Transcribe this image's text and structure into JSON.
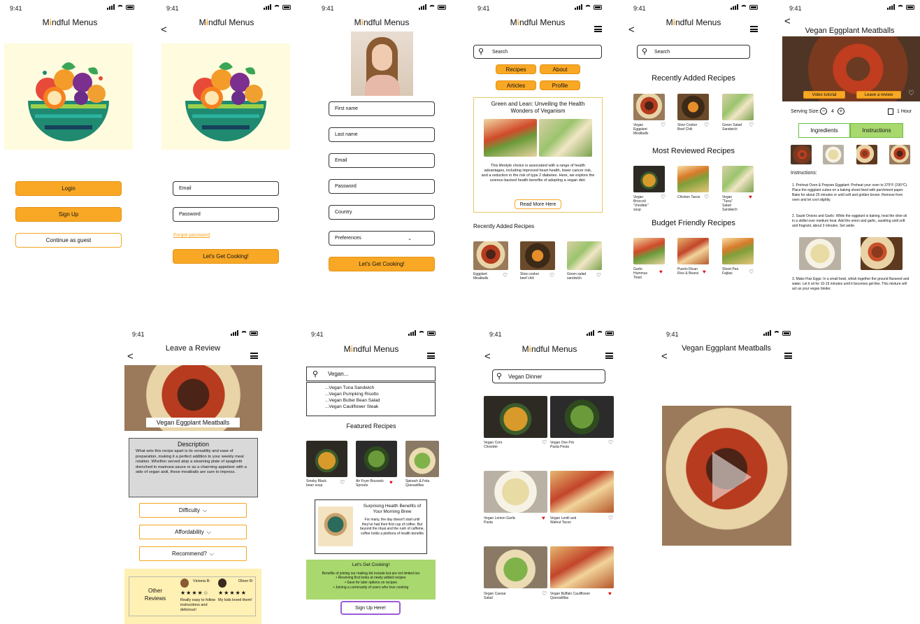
{
  "status_time": "9:41",
  "app_title_pre": "M",
  "app_title_dot": "i",
  "app_title_post": "ndful Menus",
  "s1": {
    "login": "Login",
    "signup": "Sign Up",
    "guest": "Continue as guest"
  },
  "s2": {
    "email": "Email",
    "password": "Password",
    "forgot": "Forgot password",
    "cta": "Let's Get Cooking!"
  },
  "s3": {
    "fields": [
      "First name",
      "Last name",
      "Email",
      "Password",
      "Country",
      "Preferences"
    ],
    "cta": "Let's Get Cooking!"
  },
  "s4": {
    "search": "Search",
    "nav": [
      "Recipes",
      "About",
      "Articles",
      "Profile"
    ],
    "article_title": "Green and Lean: Unveiling the Health Wonders of Veganism",
    "article_body": "This lifestyle choice is associated with a range of health advantages, including improved heart health, lower cancer risk, and a reduction in the risk of type 2 diabetes. Here, we explore the science-backed health benefits of adopting a vegan diet.",
    "read_more": "Read More Here",
    "recent_title": "Recently Added Recipes",
    "recent": [
      "Eggplant Meatballs",
      "Slow cooker beef chili",
      "Green salad sandwich"
    ]
  },
  "s5": {
    "search": "Search",
    "recent_title": "Recently Added Recipes",
    "recent": [
      "Vegan Eggplant Meatballs",
      "Slow Cooker Beef Chili",
      "Green Salad Sandwich"
    ],
    "reviewed_title": "Most Reviewed Recipes",
    "reviewed": [
      "Vegan Broccoli \"cheddar\" soup",
      "Chicken Tacos",
      "Vegan \"Tuna\" Salad Sandwich"
    ],
    "budget_title": "Budget Friendly Recipes",
    "budget": [
      "Garlic Hummus Toast",
      "Puerto Rican Rice & Beans",
      "Sheet Pan Fajitas"
    ]
  },
  "s6": {
    "title": "Vegan Eggplant Meatballs",
    "video": "Video tutorial",
    "review": "Leave a review",
    "serving": "Serving Size:",
    "serving_value": "4",
    "time": "1 Hour",
    "tab_ingredients": "Ingredients",
    "tab_instructions": "Instructions",
    "instructions_label": "Instructions:",
    "step1": "1. Preheat Oven & Prepare Eggplant: Preheat your oven to 375°F (190°C). Place the eggplant cubes on a baking sheet lined with parchment paper. Bake for about 25 minutes or until soft and golden brown. Remove from oven and let cool slightly.",
    "step2": "2. Sauté Onions and Garlic: While the eggplant is baking, heat the olive oil in a skillet over medium heat. Add the onion and garlic, sautéing until soft and fragrant, about 3 minutes. Set aside.",
    "step3": "3. Make Flax Eggs: In a small bowl, whisk together the ground flaxseed and water. Let it sit for 10-15 minutes until it becomes gel-like. This mixture will act as your vegan binder."
  },
  "s7": {
    "title": "Leave a Review",
    "recipe": "Vegan Eggplant Meatballs",
    "desc_title": "Description",
    "desc": "What sets this recipe apart is its versatility and ease of preparation, making it a perfect addition to your weekly meal rotation. Whether served atop a steaming plate of spaghetti drenched in marinara sauce or as a charming appetizer with a side of vegan aioli, these meatballs are sure to impress.",
    "difficulty": "Difficulty",
    "affordability": "Affordability",
    "recommend": "Recommend?",
    "other": "Other Reviews",
    "r1_name": "Victoria B:",
    "r1_text": "Really easy to follow instructions and delicious!",
    "r1_stars": "★★★★☆",
    "r2_name": "Oliver R:",
    "r2_text": "My kids loved them!",
    "r2_stars": "★★★★★"
  },
  "s8": {
    "search": "Vegan...",
    "suggestions": [
      "...Vegan Tuna Sandwich",
      "...Vegan Pumpking Risotto",
      "...Vegan Butter Bean Salad",
      "...Vegan Cauliflower Steak"
    ],
    "featured_title": "Featured Recipes",
    "featured": [
      "Smoky Black bean soup",
      "Air Fryer Brussels Sprouts",
      "Spinach & Feta Quesadillas"
    ],
    "article_title": "Surprising Health Benefits of Your Morning Brew",
    "article_body": "For many, the day doesn't start until they've had their first cup of coffee. But beyond the ritual and the rush of caffeine, coffee holds a plethora of health benefits",
    "cta_title": "Let's Get Cooking!",
    "cta_body": "Benefits of joining our mailing list include but are not limited too",
    "cta_items": [
      "Receiving first looks at newly added recipes",
      "Save for later options on recipes",
      "Joining a community of users who love cooking"
    ],
    "signup": "Sign Up Here!"
  },
  "s9": {
    "search": "Vegan Dinner",
    "results": [
      "Vegan Corn Chowder",
      "Vegan One Pot Pasta Pesta",
      "Vegan Lemon Garlic Pasta",
      "Vegan Lentil and Walnut Tacos",
      "Vegan Caesar Salad",
      "Vegan Buffalo Cauliflower Quesadillas"
    ]
  },
  "s10": {
    "title": "Vegan Eggplant Meatballs"
  },
  "colors": {
    "accent": "#f9a825",
    "green": "#a8d86e",
    "cream": "#fffbde"
  }
}
